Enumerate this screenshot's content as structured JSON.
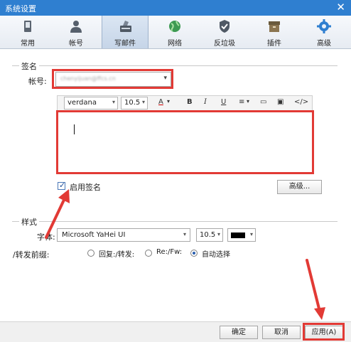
{
  "window": {
    "title": "系统设置"
  },
  "toolbar": {
    "items": [
      {
        "label": "常用",
        "icon": "general-icon"
      },
      {
        "label": "帐号",
        "icon": "account-icon"
      },
      {
        "label": "写邮件",
        "icon": "compose-icon",
        "active": true
      },
      {
        "label": "网络",
        "icon": "network-icon"
      },
      {
        "label": "反垃圾",
        "icon": "antispam-icon"
      },
      {
        "label": "插件",
        "icon": "plugin-icon"
      },
      {
        "label": "高级",
        "icon": "advanced-icon"
      }
    ]
  },
  "signature": {
    "section_title": "签名",
    "account_label": "帐号:",
    "account_value": "chenyijuan@ffcs.cn",
    "editor_toolbar": {
      "font": "verdana",
      "size": "10.5",
      "buttons": [
        "A",
        "B",
        "I",
        "U",
        "≡",
        "▭",
        "▣",
        "</>"
      ]
    },
    "enable_label": "启用签名",
    "enabled": true,
    "advanced_button": "高级..."
  },
  "style": {
    "section_title": "样式",
    "font_label": "字体:",
    "font_value": "Microsoft YaHei UI",
    "size_value": "10.5",
    "color_value": "#000000",
    "prefix_label": "/转发前缀:",
    "prefix_options": [
      {
        "label": "回复:/转发:",
        "selected": false
      },
      {
        "label": "Re:/Fw:",
        "selected": false
      },
      {
        "label": "自动选择",
        "selected": true
      }
    ]
  },
  "footer": {
    "ok": "确定",
    "cancel": "取消",
    "apply": "应用(A)"
  },
  "colors": {
    "title_bar": "#2f7fd0",
    "highlight": "#e23a35"
  }
}
